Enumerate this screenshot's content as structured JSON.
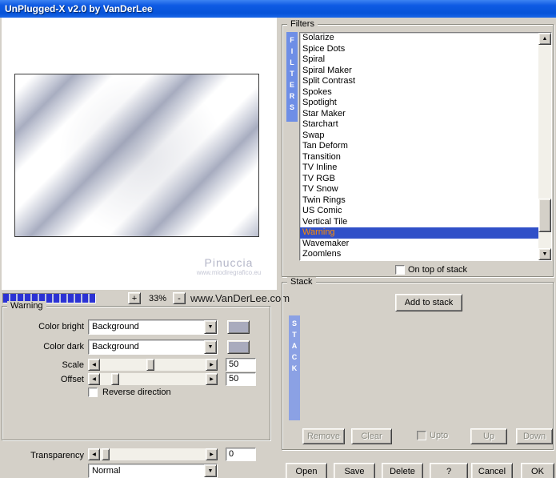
{
  "window": {
    "title": "UnPlugged-X v2.0 by VanDerLee"
  },
  "icons": {
    "arrow_up": "▲",
    "arrow_down": "▼",
    "arrow_left": "◀",
    "arrow_right": "▶"
  },
  "preview": {
    "watermark_name": "Pinuccia",
    "watermark_url": "www.miodiregrafico.eu"
  },
  "zoom": {
    "plus_label": "+",
    "level": "33%",
    "minus_label": "-",
    "site_link": "www.VanDerLee.com"
  },
  "warning_group": {
    "label": "Warning",
    "color_bright_label": "Color bright",
    "color_bright_value": "Background",
    "color_dark_label": "Color dark",
    "color_dark_value": "Background",
    "scale_label": "Scale",
    "scale_value": "50",
    "offset_label": "Offset",
    "offset_value": "50",
    "reverse_label": "Reverse direction"
  },
  "transparency": {
    "label": "Transparency",
    "value": "0",
    "blend_mode": "Normal"
  },
  "filters_group": {
    "label": "Filters",
    "strip": "FILTERS",
    "items": [
      "Solarize",
      "Spice Dots",
      "Spiral",
      "Spiral Maker",
      "Split Contrast",
      "Spokes",
      "Spotlight",
      "Star Maker",
      "Starchart",
      "Swap",
      "Tan Deform",
      "Transition",
      "TV Inline",
      "TV RGB",
      "TV Snow",
      "Twin Rings",
      "US Comic",
      "Vertical Tile",
      "Warning",
      "Wavemaker",
      "Zoomlens"
    ],
    "selected": "Warning",
    "on_top_label": "On top of stack"
  },
  "stack_group": {
    "label": "Stack",
    "strip": "STACK",
    "add_button": "Add to stack",
    "remove_button": "Remove",
    "clear_button": "Clear",
    "upto_label": "Upto",
    "up_button": "Up",
    "down_button": "Down"
  },
  "bottom_buttons": {
    "open": "Open",
    "save": "Save",
    "delete": "Delete",
    "help": "?",
    "cancel": "Cancel",
    "ok": "OK"
  },
  "colors": {
    "dialog_bg": "#d4d0c8",
    "titlebar_blue": "#0f5be4",
    "selection_bg": "#3050c8",
    "selection_text": "#ff8c00",
    "filters_strip_bg": "#6e8ee6",
    "stack_strip_bg": "#8ba1e4",
    "progress_blue": "#2b32d4",
    "swatch_bright": "#a9abbd",
    "swatch_dark": "#a9abbd"
  }
}
